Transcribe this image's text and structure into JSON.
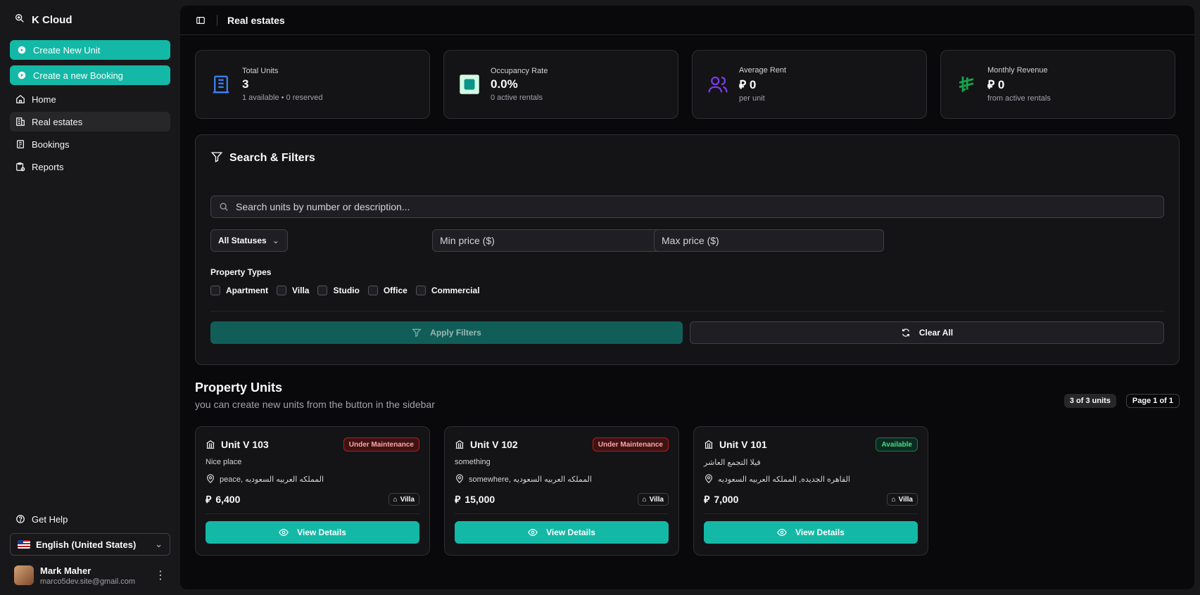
{
  "app": {
    "name": "K Cloud"
  },
  "sidebar": {
    "actions": [
      {
        "label": "Create New Unit"
      },
      {
        "label": "Create a new Booking"
      }
    ],
    "nav": [
      {
        "label": "Home"
      },
      {
        "label": "Real estates",
        "active": true
      },
      {
        "label": "Bookings"
      },
      {
        "label": "Reports"
      }
    ],
    "help_label": "Get Help",
    "language": "English (United States)",
    "user": {
      "name": "Mark Maher",
      "email": "marco5dev.site@gmail.com"
    }
  },
  "header": {
    "title": "Real estates"
  },
  "stats": [
    {
      "label": "Total Units",
      "value": "3",
      "sub": "1 available • 0 reserved",
      "color": "#3b82f6"
    },
    {
      "label": "Occupancy Rate",
      "value": "0.0%",
      "sub": "0 active rentals",
      "color": "#0d9488"
    },
    {
      "label": "Average Rent",
      "value": "0",
      "sub": "per unit",
      "color": "#7c3aed"
    },
    {
      "label": "Monthly Revenue",
      "value": "0",
      "sub": "from active rentals",
      "color": "#16a34a"
    }
  ],
  "currency_symbol": "⃁",
  "filters": {
    "title": "Search & Filters",
    "search_placeholder": "Search units by number or description...",
    "status_select": "All Statuses",
    "min_price_placeholder": "Min price ($)",
    "max_price_placeholder": "Max price ($)",
    "property_types_label": "Property Types",
    "property_types": [
      "Apartment",
      "Villa",
      "Studio",
      "Office",
      "Commercial"
    ],
    "apply_label": "Apply Filters",
    "clear_label": "Clear All"
  },
  "units_section": {
    "title": "Property Units",
    "subtitle": "you can create new units from the button in the sidebar",
    "count_pill": "3 of 3 units",
    "page_pill": "Page 1 of 1"
  },
  "units": [
    {
      "title": "Unit V 103",
      "status": "Under Maintenance",
      "status_kind": "maint",
      "description": "Nice place",
      "location": "peace, المملكه العربيه السعوديه",
      "price": "6,400",
      "type": "Villa",
      "button": "View Details"
    },
    {
      "title": "Unit V 102",
      "status": "Under Maintenance",
      "status_kind": "maint",
      "description": "something",
      "location": "somewhere, المملكه العربيه السعوديه",
      "price": "15,000",
      "type": "Villa",
      "button": "View Details"
    },
    {
      "title": "Unit V 101",
      "status": "Available",
      "status_kind": "avail",
      "description": "فيلا التجمع العاشر",
      "location": "القاهره الجديده, المملكه العربيه السعوديه",
      "price": "7,000",
      "type": "Villa",
      "button": "View Details"
    }
  ],
  "colors": {
    "accent": "#14b8a6",
    "accent_dark": "#115e59",
    "danger": "#b91c1c",
    "success": "#15803d"
  }
}
